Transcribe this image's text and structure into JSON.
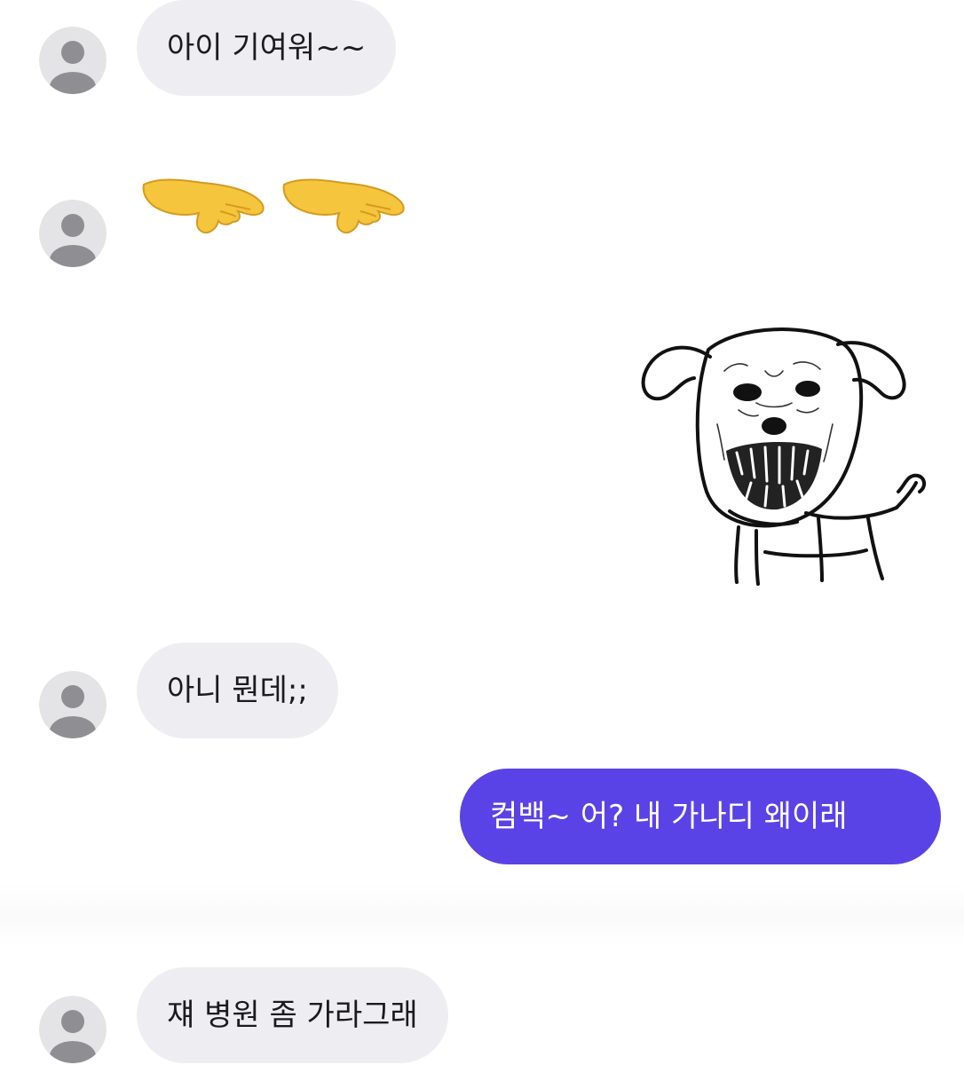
{
  "conversation": {
    "messages": [
      {
        "sender": "other",
        "kind": "text",
        "text": "아이 기여워~~"
      },
      {
        "sender": "other",
        "kind": "emoji",
        "emoji_icons": [
          "hand-pointing-right-icon",
          "hand-pointing-right-icon"
        ]
      },
      {
        "sender": "me",
        "kind": "sticker",
        "sticker_icon": "angry-dog-sticker"
      },
      {
        "sender": "other",
        "kind": "text",
        "text": "아니 뭔데;;"
      },
      {
        "sender": "me",
        "kind": "text",
        "text": "컴백~ 어? 내 가나디 왜이래"
      },
      {
        "sender": "other",
        "kind": "text",
        "text": "쟤 병원 좀 가라그래"
      }
    ]
  },
  "colors": {
    "incoming_bubble": "#eeeef2",
    "outgoing_bubble": "#5a43e6",
    "avatar_bg": "#e4e4e6",
    "avatar_fg": "#8f8f93",
    "emoji_hand": "#f5c53d"
  }
}
